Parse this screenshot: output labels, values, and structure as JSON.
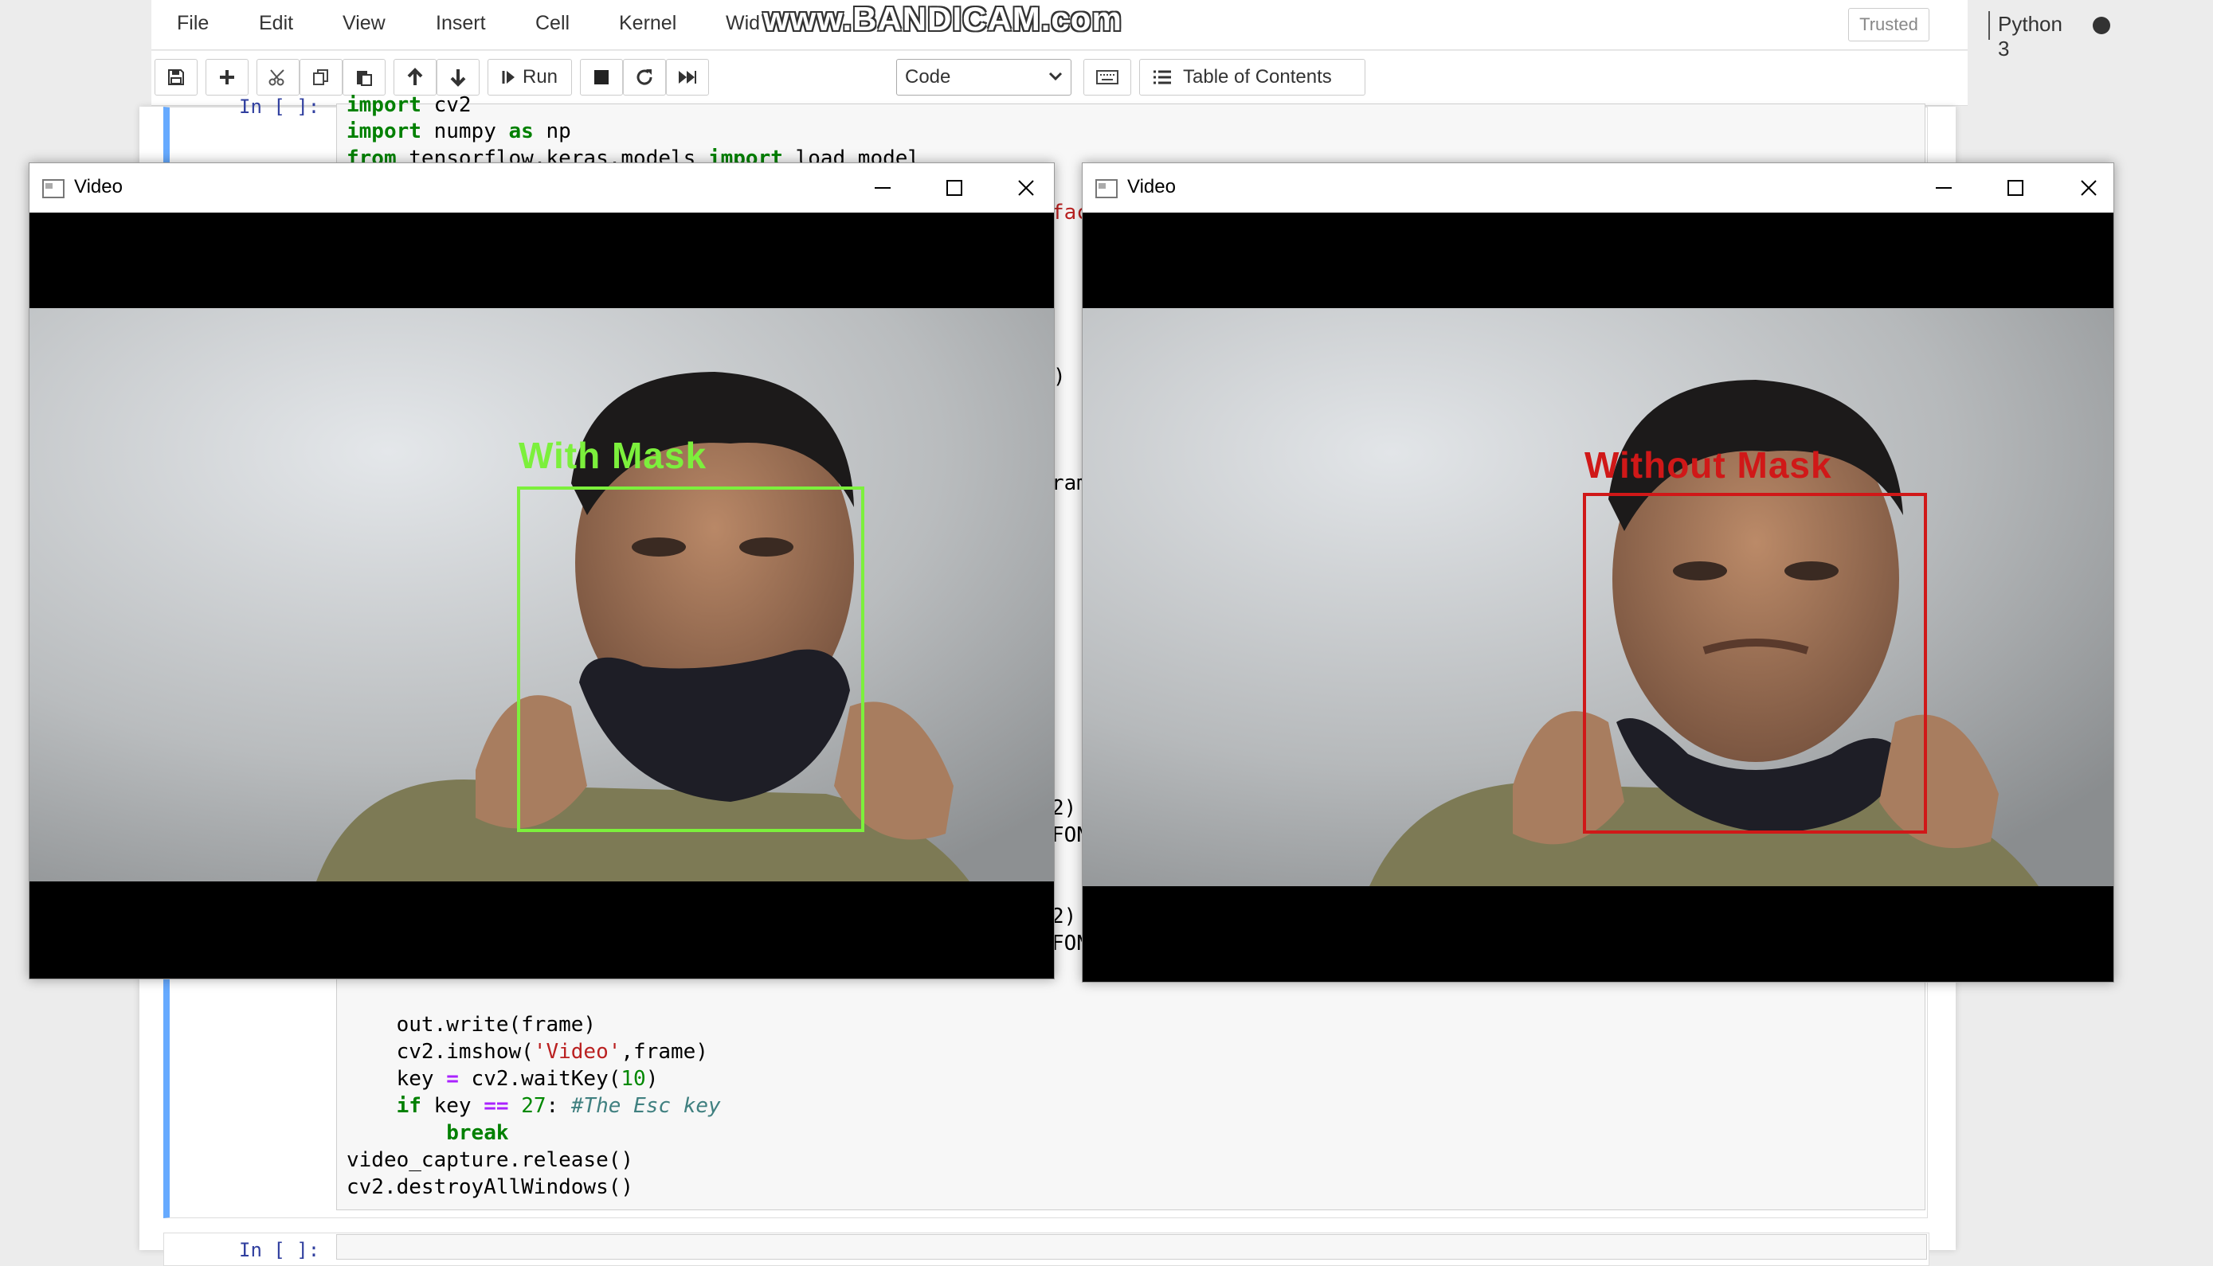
{
  "menu": {
    "items": [
      "File",
      "Edit",
      "View",
      "Insert",
      "Cell",
      "Kernel",
      "Wid"
    ]
  },
  "watermark": "www.BANDICAM.com",
  "header": {
    "trusted": "Trusted",
    "kernel": "Python 3"
  },
  "toolbar": {
    "run_label": "Run",
    "cell_type": "Code",
    "toc_label": "Table of Contents",
    "icons": [
      "save-icon",
      "plus-icon",
      "cut-icon",
      "copy-icon",
      "paste-icon",
      "arrow-up-icon",
      "arrow-down-icon",
      "run-icon",
      "stop-icon",
      "restart-icon",
      "fast-forward-icon",
      "keyboard-icon",
      "list-icon"
    ]
  },
  "cell": {
    "prompt": "In [ ]:",
    "code_top": [
      "import cv2",
      "import numpy as np",
      "from tensorflow.keras.models import load_model"
    ],
    "code_bottom": [
      "    out.write(frame)",
      "    cv2.imshow('Video',frame)",
      "    key = cv2.waitKey(10)",
      "    if key == 27: #The Esc key",
      "        break",
      "video_capture.release()",
      "cv2.destroyAllWindows()"
    ],
    "code_fragments": [
      "fac",
      ")",
      "ram",
      "2)",
      "FON",
      "2)",
      "FON"
    ]
  },
  "next_cell": {
    "prompt": "In [ ]:"
  },
  "windows": [
    {
      "title": "Video",
      "detection": {
        "label": "With Mask",
        "color": "#7cf03c"
      }
    },
    {
      "title": "Video",
      "detection": {
        "label": "Without Mask",
        "color": "#d01818"
      }
    }
  ]
}
